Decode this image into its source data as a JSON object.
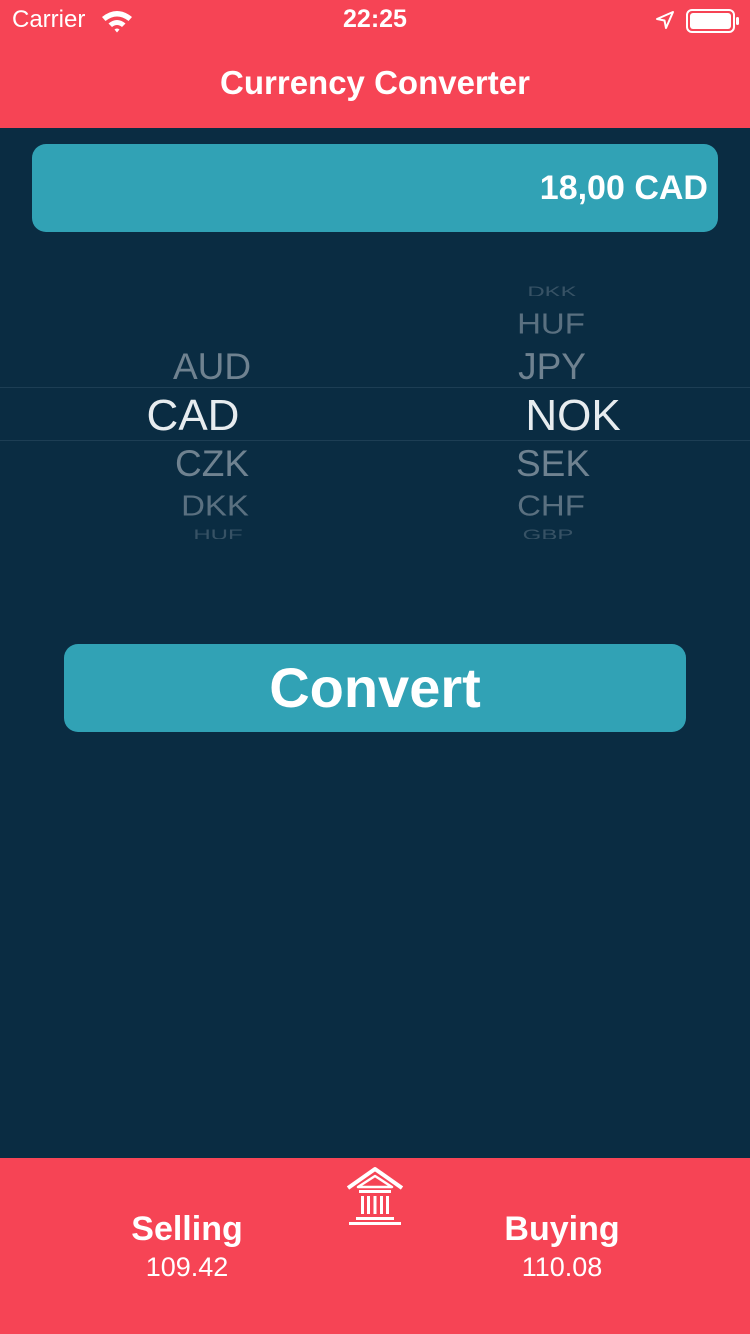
{
  "status": {
    "carrier": "Carrier",
    "time": "22:25"
  },
  "nav": {
    "title": "Currency Converter"
  },
  "amount": {
    "value": "18,00 CAD"
  },
  "picker": {
    "from": {
      "items": [
        "AUD",
        "CAD",
        "CZK",
        "DKK",
        "HUF"
      ],
      "selected": "CAD"
    },
    "to": {
      "items": [
        "DKK",
        "HUF",
        "JPY",
        "NOK",
        "SEK",
        "CHF",
        "GBP"
      ],
      "selected": "NOK"
    }
  },
  "actions": {
    "convert_label": "Convert"
  },
  "rates": {
    "selling_label": "Selling",
    "selling_value": "109.42",
    "buying_label": "Buying",
    "buying_value": "110.08"
  },
  "colors": {
    "accent": "#f64455",
    "background": "#0a2c42",
    "field": "#31a2b5",
    "text": "#ffffff"
  },
  "icons": {
    "wifi": "wifi-icon",
    "location": "location-arrow-icon",
    "battery": "battery-icon",
    "bank": "bank-icon"
  }
}
